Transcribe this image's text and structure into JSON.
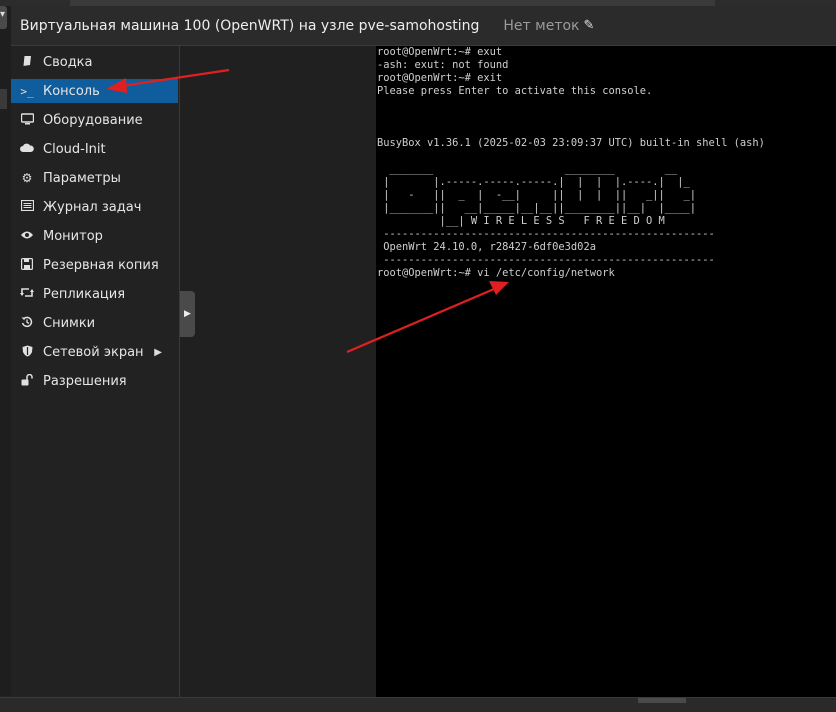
{
  "header": {
    "title": "Виртуальная машина 100 (OpenWRT) на узле pve-samohosting",
    "tags_label": "Нет меток"
  },
  "sidebar": {
    "items": [
      {
        "label": "Сводка",
        "icon": "book-icon",
        "active": false
      },
      {
        "label": "Консоль",
        "icon": "terminal-icon",
        "active": true
      },
      {
        "label": "Оборудование",
        "icon": "monitor-icon",
        "active": false
      },
      {
        "label": "Cloud-Init",
        "icon": "cloud-icon",
        "active": false
      },
      {
        "label": "Параметры",
        "icon": "gear-icon",
        "active": false
      },
      {
        "label": "Журнал задач",
        "icon": "list-icon",
        "active": false
      },
      {
        "label": "Монитор",
        "icon": "eye-icon",
        "active": false
      },
      {
        "label": "Резервная копия",
        "icon": "floppy-icon",
        "active": false
      },
      {
        "label": "Репликация",
        "icon": "retweet-icon",
        "active": false
      },
      {
        "label": "Снимки",
        "icon": "history-icon",
        "active": false
      },
      {
        "label": "Сетевой экран",
        "icon": "shield-icon",
        "active": false,
        "has_submenu": true
      },
      {
        "label": "Разрешения",
        "icon": "unlock-icon",
        "active": false
      }
    ]
  },
  "console": {
    "lines": [
      "root@OpenWrt:~# exut",
      "-ash: exut: not found",
      "root@OpenWrt:~# exit",
      "Please press Enter to activate this console.",
      "",
      "",
      "",
      "BusyBox v1.36.1 (2025-02-03 23:09:37 UTC) built-in shell (ash)",
      "",
      "  _______                     ________        __",
      " |       |.-----.-----.-----.|  |  |  |.----.|  |_",
      " |   -   ||  _  |  -__|     ||  |  |  ||   _||   _|",
      " |_______||   __|_____|__|__||________||__|  |____|",
      "          |__| W I R E L E S S   F R E E D O M",
      " -----------------------------------------------------",
      " OpenWrt 24.10.0, r28427-6df0e3d02a",
      " -----------------------------------------------------",
      "root@OpenWrt:~# vi /etc/config/network"
    ]
  },
  "colors": {
    "active_bg": "#0f5d9c",
    "annotation_arrow": "#e02020",
    "console_bg": "#000000"
  }
}
